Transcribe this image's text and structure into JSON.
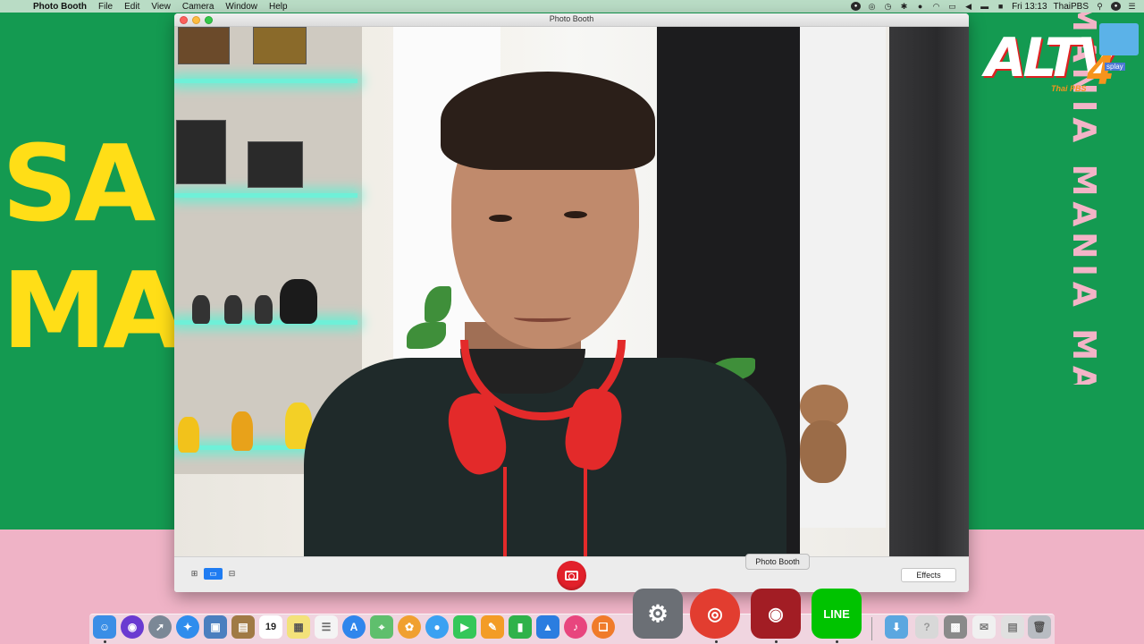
{
  "menubar": {
    "app_name": "Photo Booth",
    "menus": [
      "File",
      "Edit",
      "View",
      "Camera",
      "Window",
      "Help"
    ],
    "clock": "Fri 13:13",
    "user": "ThaiPBS"
  },
  "wallpaper": {
    "word1": "SA",
    "word2": "MA",
    "vertical_text": "MANIA MANIA MANIA",
    "logo_main": "ALTV",
    "logo_num": "4",
    "logo_sub": "Thai PBS",
    "folder_label": "splay"
  },
  "window": {
    "title": "Photo Booth"
  },
  "toolbar": {
    "effects_label": "Effects",
    "view_modes": [
      "four-up",
      "single",
      "filmstrip"
    ],
    "active_view": "single"
  },
  "tooltip": {
    "text": "Photo Booth"
  },
  "dock": {
    "apps": [
      {
        "name": "Finder",
        "icon": "finder-icon",
        "color": "#3a8ee6"
      },
      {
        "name": "Siri",
        "icon": "siri-icon",
        "color": "#6a3bd1"
      },
      {
        "name": "Launchpad",
        "icon": "launchpad-icon",
        "color": "#7b8896"
      },
      {
        "name": "Safari",
        "icon": "safari-icon",
        "color": "#2f8ded"
      },
      {
        "name": "Preview",
        "icon": "preview-icon",
        "color": "#4b7fbf"
      },
      {
        "name": "Notes",
        "icon": "notebook-icon",
        "color": "#a07a45"
      },
      {
        "name": "Calendar",
        "icon": "calendar-icon",
        "color": "#ffffff"
      },
      {
        "name": "Stickies",
        "icon": "stickies-icon",
        "color": "#f3e27a"
      },
      {
        "name": "Reminders",
        "icon": "reminders-icon",
        "color": "#f4f4f4"
      },
      {
        "name": "App Store",
        "icon": "app-store-icon",
        "color": "#2f86ec"
      },
      {
        "name": "Maps",
        "icon": "maps-icon",
        "color": "#5fbf6d"
      },
      {
        "name": "Photos",
        "icon": "photos-icon",
        "color": "#f0a030"
      },
      {
        "name": "Messages",
        "icon": "messages-icon",
        "color": "#3aa1f2"
      },
      {
        "name": "FaceTime",
        "icon": "facetime-icon",
        "color": "#34c759"
      },
      {
        "name": "Pages",
        "icon": "pages-icon",
        "color": "#f39c26"
      },
      {
        "name": "Numbers",
        "icon": "numbers-icon",
        "color": "#2fb24a"
      },
      {
        "name": "Keynote",
        "icon": "keynote-icon",
        "color": "#2b7de0"
      },
      {
        "name": "iTunes",
        "icon": "music-icon",
        "color": "#e8457e"
      },
      {
        "name": "Books",
        "icon": "books-icon",
        "color": "#f07b2a"
      },
      {
        "name": "System Preferences",
        "icon": "gear-icon",
        "color": "#6b6f75"
      },
      {
        "name": "Chrome",
        "icon": "chrome-icon",
        "color": "#e23d30"
      },
      {
        "name": "Photo Booth",
        "icon": "photo-booth-icon",
        "color": "#a21d24"
      },
      {
        "name": "LINE",
        "icon": "line-icon",
        "color": "#00c300"
      },
      {
        "name": "Downloads",
        "icon": "downloads-folder-icon",
        "color": "#5ba7e0"
      },
      {
        "name": "Unknown",
        "icon": "question-icon",
        "color": "#d8d8d8"
      },
      {
        "name": "Photos Stack",
        "icon": "photo-stack-icon",
        "color": "#8a8a8a"
      },
      {
        "name": "Document Stack",
        "icon": "document-stack-icon",
        "color": "#f0f0f0"
      },
      {
        "name": "Files Stack",
        "icon": "files-stack-icon",
        "color": "#e0e0e0"
      },
      {
        "name": "Trash",
        "icon": "trash-icon",
        "color": "#b8bcc2"
      }
    ],
    "calendar_day": "19",
    "line_label": "LINE"
  }
}
